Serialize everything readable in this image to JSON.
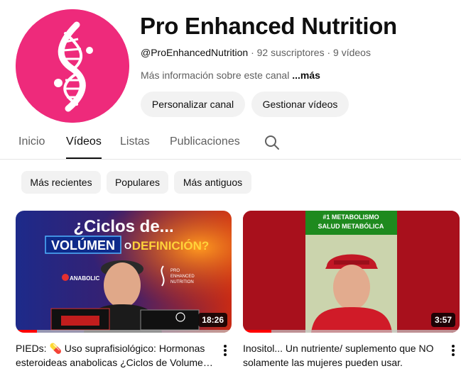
{
  "channel": {
    "title": "Pro Enhanced Nutrition",
    "handle": "@ProEnhancedNutrition",
    "separator": "·",
    "subscribers": "92 suscriptores",
    "videos_count": "9 vídeos",
    "description": "Más información sobre este canal",
    "more_label": "...más",
    "avatar_icon": "dna-helix-icon",
    "avatar_color": "#ee2a7b"
  },
  "buttons": {
    "customize": "Personalizar canal",
    "manage": "Gestionar vídeos"
  },
  "tabs": [
    {
      "label": "Inicio",
      "active": false
    },
    {
      "label": "Vídeos",
      "active": true
    },
    {
      "label": "Listas",
      "active": false
    },
    {
      "label": "Publicaciones",
      "active": false
    }
  ],
  "search_icon": "search-icon",
  "chips": [
    {
      "label": "Más recientes"
    },
    {
      "label": "Populares"
    },
    {
      "label": "Más antiguos"
    }
  ],
  "videos": [
    {
      "title": "PIEDs: 💊 Uso suprafisiológico: Hormonas esteroideas anabolicas ¿Ciclos de Volumen o Definición?",
      "duration": "18:26",
      "watched_fraction": 0.1,
      "thumbnail": {
        "line1": "¿Ciclos de...",
        "word_a": "VOLÚMEN",
        "connector": "O",
        "word_b": "DEFINICIÓN?",
        "brand_left": "ANABOLIC",
        "brand_right_a": "PRO",
        "brand_right_b": "ENHANCED",
        "brand_right_c": "NUTRITION"
      }
    },
    {
      "title": "Inositol... Un nutriente/ suplemento que NO solamente las mujeres pueden usar.",
      "duration": "3:57",
      "watched_fraction": 0.13,
      "thumbnail": {
        "line1": "#1 METABOLISMO",
        "line2": "SALUD METABÓLICA"
      }
    }
  ]
}
